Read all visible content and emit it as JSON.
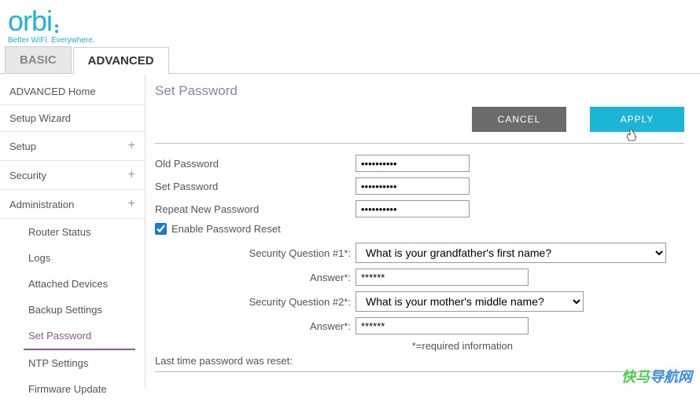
{
  "brand": {
    "name": "orbi",
    "tagline": "Better WiFi. Everywhere."
  },
  "tabs": {
    "basic": "BASIC",
    "advanced": "ADVANCED"
  },
  "sidebar": {
    "advancedHome": "ADVANCED Home",
    "setupWizard": "Setup Wizard",
    "setup": "Setup",
    "security": "Security",
    "administration": "Administration",
    "subs": {
      "routerStatus": "Router Status",
      "logs": "Logs",
      "attachedDevices": "Attached Devices",
      "backupSettings": "Backup Settings",
      "setPassword": "Set Password",
      "ntpSettings": "NTP Settings",
      "firmwareUpdate": "Firmware Update"
    }
  },
  "main": {
    "title": "Set Password",
    "cancel": "CANCEL",
    "apply": "APPLY",
    "oldPassword": "Old Password",
    "oldPasswordVal": "••••••••••",
    "setPassword": "Set Password",
    "setPasswordVal": "••••••••••",
    "repeatPassword": "Repeat New Password",
    "repeatPasswordVal": "••••••••••",
    "enableReset": "Enable Password Reset",
    "sq1": "Security Question #1*:",
    "sq1Val": "What is your grandfather's first name?",
    "answer1": "Answer*:",
    "answer1Val": "******",
    "sq2": "Security Question #2*:",
    "sq2Val": "What is your mother's middle name?",
    "answer2": "Answer*:",
    "answer2Val": "******",
    "requiredInfo": "*=required information",
    "lastReset": "Last time password was reset:"
  },
  "watermark": {
    "part1": "快马",
    "part2": "导航网"
  }
}
